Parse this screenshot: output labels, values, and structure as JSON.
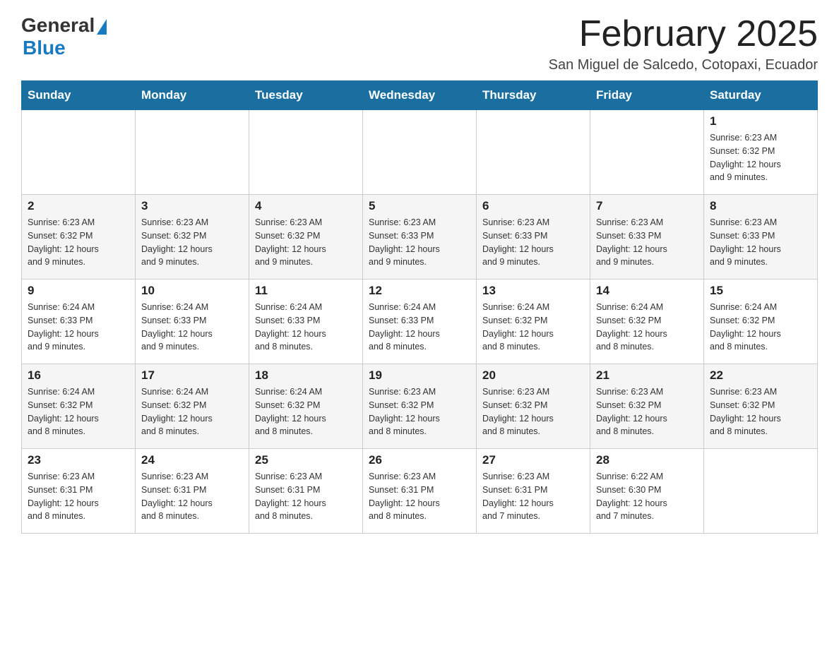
{
  "logo": {
    "general": "General",
    "blue": "Blue"
  },
  "title": "February 2025",
  "subtitle": "San Miguel de Salcedo, Cotopaxi, Ecuador",
  "headers": [
    "Sunday",
    "Monday",
    "Tuesday",
    "Wednesday",
    "Thursday",
    "Friday",
    "Saturday"
  ],
  "weeks": [
    [
      {
        "day": "",
        "info": ""
      },
      {
        "day": "",
        "info": ""
      },
      {
        "day": "",
        "info": ""
      },
      {
        "day": "",
        "info": ""
      },
      {
        "day": "",
        "info": ""
      },
      {
        "day": "",
        "info": ""
      },
      {
        "day": "1",
        "info": "Sunrise: 6:23 AM\nSunset: 6:32 PM\nDaylight: 12 hours\nand 9 minutes."
      }
    ],
    [
      {
        "day": "2",
        "info": "Sunrise: 6:23 AM\nSunset: 6:32 PM\nDaylight: 12 hours\nand 9 minutes."
      },
      {
        "day": "3",
        "info": "Sunrise: 6:23 AM\nSunset: 6:32 PM\nDaylight: 12 hours\nand 9 minutes."
      },
      {
        "day": "4",
        "info": "Sunrise: 6:23 AM\nSunset: 6:32 PM\nDaylight: 12 hours\nand 9 minutes."
      },
      {
        "day": "5",
        "info": "Sunrise: 6:23 AM\nSunset: 6:33 PM\nDaylight: 12 hours\nand 9 minutes."
      },
      {
        "day": "6",
        "info": "Sunrise: 6:23 AM\nSunset: 6:33 PM\nDaylight: 12 hours\nand 9 minutes."
      },
      {
        "day": "7",
        "info": "Sunrise: 6:23 AM\nSunset: 6:33 PM\nDaylight: 12 hours\nand 9 minutes."
      },
      {
        "day": "8",
        "info": "Sunrise: 6:23 AM\nSunset: 6:33 PM\nDaylight: 12 hours\nand 9 minutes."
      }
    ],
    [
      {
        "day": "9",
        "info": "Sunrise: 6:24 AM\nSunset: 6:33 PM\nDaylight: 12 hours\nand 9 minutes."
      },
      {
        "day": "10",
        "info": "Sunrise: 6:24 AM\nSunset: 6:33 PM\nDaylight: 12 hours\nand 9 minutes."
      },
      {
        "day": "11",
        "info": "Sunrise: 6:24 AM\nSunset: 6:33 PM\nDaylight: 12 hours\nand 8 minutes."
      },
      {
        "day": "12",
        "info": "Sunrise: 6:24 AM\nSunset: 6:33 PM\nDaylight: 12 hours\nand 8 minutes."
      },
      {
        "day": "13",
        "info": "Sunrise: 6:24 AM\nSunset: 6:32 PM\nDaylight: 12 hours\nand 8 minutes."
      },
      {
        "day": "14",
        "info": "Sunrise: 6:24 AM\nSunset: 6:32 PM\nDaylight: 12 hours\nand 8 minutes."
      },
      {
        "day": "15",
        "info": "Sunrise: 6:24 AM\nSunset: 6:32 PM\nDaylight: 12 hours\nand 8 minutes."
      }
    ],
    [
      {
        "day": "16",
        "info": "Sunrise: 6:24 AM\nSunset: 6:32 PM\nDaylight: 12 hours\nand 8 minutes."
      },
      {
        "day": "17",
        "info": "Sunrise: 6:24 AM\nSunset: 6:32 PM\nDaylight: 12 hours\nand 8 minutes."
      },
      {
        "day": "18",
        "info": "Sunrise: 6:24 AM\nSunset: 6:32 PM\nDaylight: 12 hours\nand 8 minutes."
      },
      {
        "day": "19",
        "info": "Sunrise: 6:23 AM\nSunset: 6:32 PM\nDaylight: 12 hours\nand 8 minutes."
      },
      {
        "day": "20",
        "info": "Sunrise: 6:23 AM\nSunset: 6:32 PM\nDaylight: 12 hours\nand 8 minutes."
      },
      {
        "day": "21",
        "info": "Sunrise: 6:23 AM\nSunset: 6:32 PM\nDaylight: 12 hours\nand 8 minutes."
      },
      {
        "day": "22",
        "info": "Sunrise: 6:23 AM\nSunset: 6:32 PM\nDaylight: 12 hours\nand 8 minutes."
      }
    ],
    [
      {
        "day": "23",
        "info": "Sunrise: 6:23 AM\nSunset: 6:31 PM\nDaylight: 12 hours\nand 8 minutes."
      },
      {
        "day": "24",
        "info": "Sunrise: 6:23 AM\nSunset: 6:31 PM\nDaylight: 12 hours\nand 8 minutes."
      },
      {
        "day": "25",
        "info": "Sunrise: 6:23 AM\nSunset: 6:31 PM\nDaylight: 12 hours\nand 8 minutes."
      },
      {
        "day": "26",
        "info": "Sunrise: 6:23 AM\nSunset: 6:31 PM\nDaylight: 12 hours\nand 8 minutes."
      },
      {
        "day": "27",
        "info": "Sunrise: 6:23 AM\nSunset: 6:31 PM\nDaylight: 12 hours\nand 7 minutes."
      },
      {
        "day": "28",
        "info": "Sunrise: 6:22 AM\nSunset: 6:30 PM\nDaylight: 12 hours\nand 7 minutes."
      },
      {
        "day": "",
        "info": ""
      }
    ]
  ]
}
